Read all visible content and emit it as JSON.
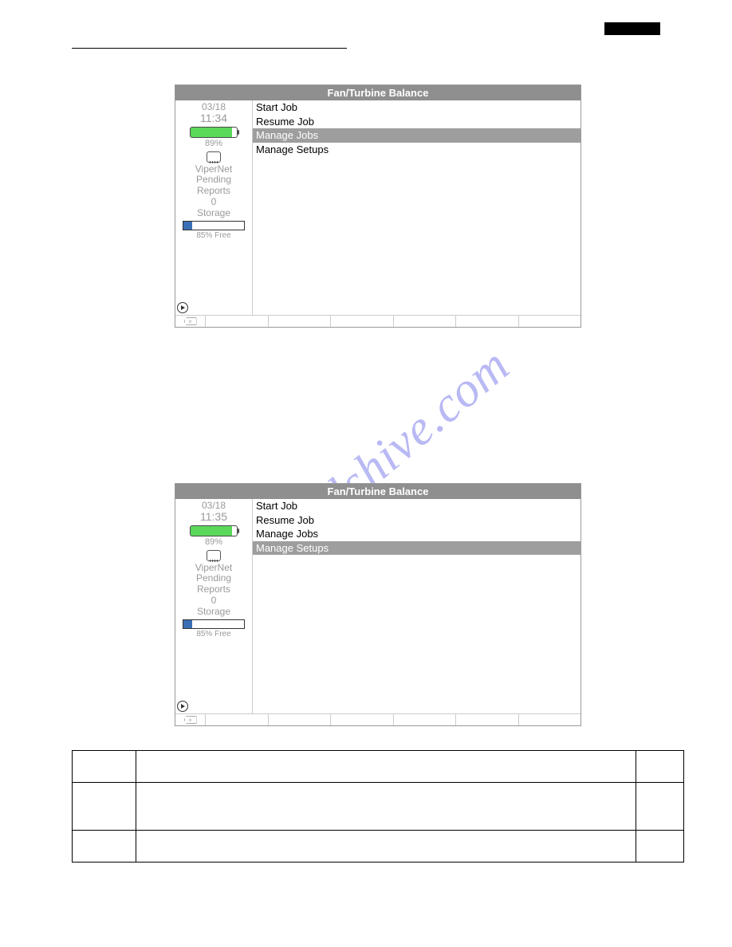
{
  "watermark_text": "manualshive.com",
  "screenshot1": {
    "title": "Fan/Turbine Balance",
    "sidebar": {
      "date": "03/18",
      "time": "11:34",
      "battery_pct": "89%",
      "net_label": "ViperNet",
      "pending_label": "Pending",
      "reports_label": "Reports",
      "reports_count": "0",
      "storage_label": "Storage",
      "free_label": "85% Free"
    },
    "menu": {
      "items": [
        {
          "label": "Start Job",
          "selected": false
        },
        {
          "label": "Resume Job",
          "selected": false
        },
        {
          "label": "Manage Jobs",
          "selected": true
        },
        {
          "label": "Manage Setups",
          "selected": false
        }
      ]
    }
  },
  "screenshot2": {
    "title": "Fan/Turbine Balance",
    "sidebar": {
      "date": "03/18",
      "time": "11:35",
      "battery_pct": "89%",
      "net_label": "ViperNet",
      "pending_label": "Pending",
      "reports_label": "Reports",
      "reports_count": "0",
      "storage_label": "Storage",
      "free_label": "85% Free"
    },
    "menu": {
      "items": [
        {
          "label": "Start Job",
          "selected": false
        },
        {
          "label": "Resume Job",
          "selected": false
        },
        {
          "label": "Manage Jobs",
          "selected": false
        },
        {
          "label": "Manage Setups",
          "selected": true
        }
      ]
    }
  }
}
